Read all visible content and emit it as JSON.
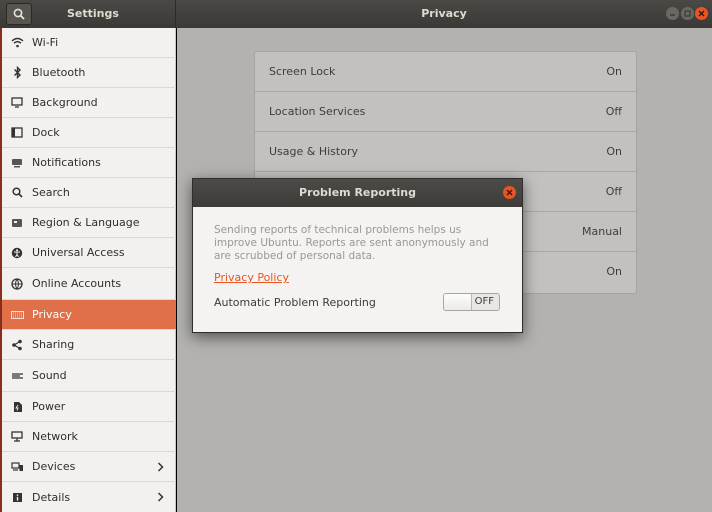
{
  "window": {
    "app_title": "Settings",
    "panel_title": "Privacy",
    "accent_color": "#e95420"
  },
  "sidebar": {
    "items": [
      {
        "label": "Wi-Fi",
        "icon": "wifi-icon"
      },
      {
        "label": "Bluetooth",
        "icon": "bluetooth-icon"
      },
      {
        "label": "Background",
        "icon": "background-icon"
      },
      {
        "label": "Dock",
        "icon": "dock-icon"
      },
      {
        "label": "Notifications",
        "icon": "notifications-icon"
      },
      {
        "label": "Search",
        "icon": "search-icon"
      },
      {
        "label": "Region & Language",
        "icon": "region-icon"
      },
      {
        "label": "Universal Access",
        "icon": "universal-access-icon"
      },
      {
        "label": "Online Accounts",
        "icon": "online-accounts-icon"
      },
      {
        "label": "Privacy",
        "icon": "privacy-icon",
        "selected": true
      },
      {
        "label": "Sharing",
        "icon": "sharing-icon"
      },
      {
        "label": "Sound",
        "icon": "sound-icon"
      },
      {
        "label": "Power",
        "icon": "power-icon"
      },
      {
        "label": "Network",
        "icon": "network-icon"
      },
      {
        "label": "Devices",
        "icon": "devices-icon",
        "has_submenu": true
      },
      {
        "label": "Details",
        "icon": "details-icon",
        "has_submenu": true
      }
    ]
  },
  "privacy": {
    "rows": [
      {
        "label": "Screen Lock",
        "value": "On"
      },
      {
        "label": "Location Services",
        "value": "Off"
      },
      {
        "label": "Usage & History",
        "value": "On"
      },
      {
        "label": "",
        "value": "Off"
      },
      {
        "label": "",
        "value": "Manual"
      },
      {
        "label": "",
        "value": "On"
      }
    ]
  },
  "dialog": {
    "title": "Problem Reporting",
    "description": "Sending reports of technical problems helps us improve Ubuntu. Reports are sent anonymously and are scrubbed of personal data.",
    "link": "Privacy Policy",
    "setting_label": "Automatic Problem Reporting",
    "switch_state": "OFF"
  }
}
